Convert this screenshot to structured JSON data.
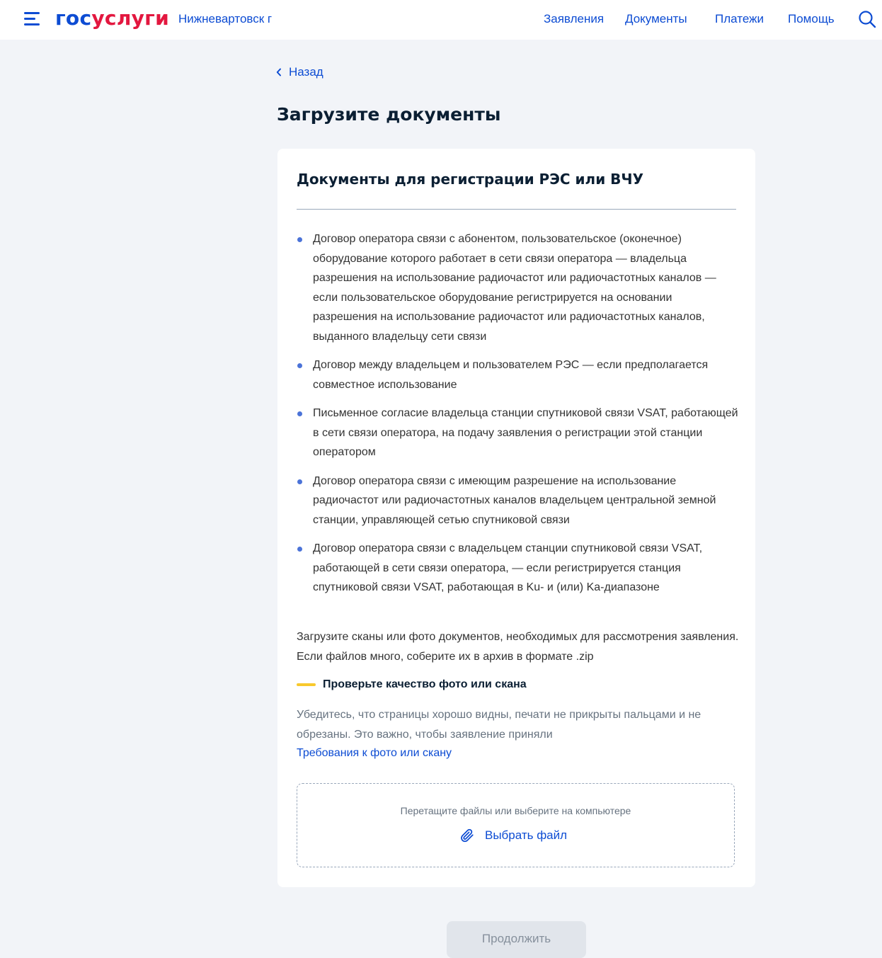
{
  "header": {
    "logo_part1": "гос",
    "logo_part2": "услуги",
    "city": "Нижневартовск г",
    "nav": [
      "Заявления",
      "Документы",
      "Платежи",
      "Помощь"
    ]
  },
  "back_label": "Назад",
  "page_title": "Загрузите документы",
  "card": {
    "title": "Документы для регистрации РЭС или ВЧУ",
    "documents": [
      "Договор оператора связи с абонентом, пользовательское (оконечное) оборудование которого работает в сети связи оператора — владельца разрешения на использование радиочастот или радиочастотных каналов — если пользовательское оборудование регистрируется на основании разрешения на использование радиочастот или радиочастотных каналов, выданного владельцу сети связи",
      "Договор между владельцем и пользователем РЭС — если предполагается совместное использование",
      "Письменное согласие владельца станции спутниковой связи VSAT, работающей в сети связи оператора, на подачу заявления о регистрации этой станции оператором",
      "Договор оператора связи с имеющим разрешение на использование радиочастот или радиочастотных каналов владельцем центральной земной станции, управляющей сетью спутниковой связи",
      "Договор оператора связи с владельцем станции спутниковой связи VSAT, работающей в сети связи оператора, — если регистрируется станция спутниковой связи VSAT, работающая в Ku- и (или) Ka-диапазоне"
    ],
    "upload_hint": "Загрузите сканы или фото документов, необходимых для рассмотрения заявления. Если файлов много, соберите их в архив в формате .zip",
    "quality_title": "Проверьте качество фото или скана",
    "quality_text": "Убедитесь, что страницы хорошо видны, печати не прикрыты пальцами и не обрезаны. Это важно, чтобы заявление приняли",
    "requirements_link": "Требования к фото или скану",
    "dropzone": {
      "hint": "Перетащите файлы или выберите на компьютере",
      "choose_label": "Выбрать файл"
    }
  },
  "continue_label": "Продолжить",
  "colors": {
    "accent": "#0d4cd3",
    "brand_red": "#e3173f",
    "warning": "#f8c92d",
    "background": "#f2f4f8",
    "disabled_button": "#e1e5eb"
  },
  "icons": {
    "menu": "burger-menu-icon",
    "search": "search-icon",
    "back": "chevron-left-icon",
    "attach": "paperclip-icon"
  }
}
